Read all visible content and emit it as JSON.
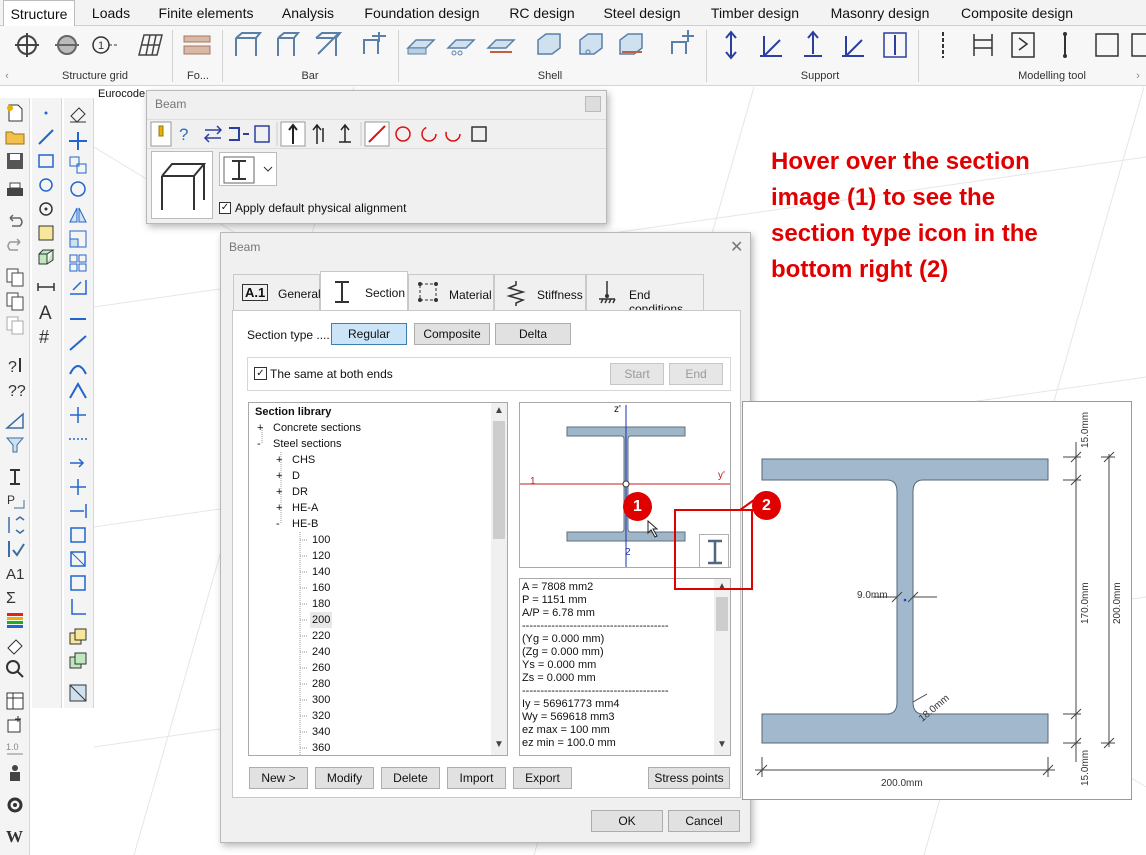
{
  "menu": {
    "tabs": [
      "Structure",
      "Loads",
      "Finite elements",
      "Analysis",
      "Foundation design",
      "RC design",
      "Steel design",
      "Timber design",
      "Masonry design",
      "Composite design"
    ]
  },
  "ribbon": {
    "groups": [
      "Structure grid",
      "Fo...",
      "Bar",
      "Shell",
      "Support",
      "Modelling tool"
    ]
  },
  "viewport": {
    "label": "Eurocode"
  },
  "beam_palette": {
    "title": "Beam",
    "apply_default_label": "Apply default physical alignment",
    "apply_default_checked": true
  },
  "beam_dialog": {
    "title": "Beam",
    "tabs": [
      {
        "label": "General",
        "badge": "A.1"
      },
      {
        "label": "Section"
      },
      {
        "label": "Material"
      },
      {
        "label": "Stiffness"
      },
      {
        "label": "End conditions"
      }
    ],
    "section_type_label": "Section type ....",
    "section_types": [
      "Regular",
      "Composite",
      "Delta"
    ],
    "selected_section_type": "Regular",
    "same_ends_label": "The same at both ends",
    "same_ends_checked": true,
    "start_label": "Start",
    "end_label": "End",
    "library": {
      "heading": "Section library",
      "items": [
        {
          "label": "Concrete sections",
          "toggle": "+"
        },
        {
          "label": "Steel sections",
          "toggle": "-"
        },
        {
          "label": "CHS",
          "toggle": "+"
        },
        {
          "label": "D",
          "toggle": "+"
        },
        {
          "label": "DR",
          "toggle": "+"
        },
        {
          "label": "HE-A",
          "toggle": "+"
        },
        {
          "label": "HE-B",
          "toggle": "-"
        }
      ],
      "sizes": [
        "100",
        "120",
        "140",
        "160",
        "180",
        "200",
        "220",
        "240",
        "260",
        "280",
        "300",
        "320",
        "340",
        "360"
      ],
      "selected_size": "200"
    },
    "preview": {
      "axis_z": "z'",
      "axis_y": "y'",
      "label_1": "1",
      "label_2": "2"
    },
    "properties": [
      "A       =  7808 mm2",
      "P       =  1151 mm",
      "A/P     =  6.78 mm",
      "----------------------------------------",
      "(Yg     =  0.000 mm)",
      "(Zg     =  0.000 mm)",
      "Ys      =  0.000 mm",
      "Zs      =  0.000 mm",
      "----------------------------------------",
      "Iy      =  56961773 mm4",
      "Wy      =  569618 mm3",
      "ez max  =  100 mm",
      "ez min  =  100.0 mm"
    ],
    "buttons": {
      "new": "New >",
      "modify": "Modify",
      "delete": "Delete",
      "import": "Import",
      "export": "Export",
      "stress_points": "Stress points",
      "ok": "OK",
      "cancel": "Cancel"
    }
  },
  "section_detail": {
    "dim_15_top": "15.0mm",
    "dim_170": "170.0mm",
    "dim_200_height": "200.0mm",
    "dim_15_bottom": "15.0mm",
    "dim_web": "9.0mm",
    "dim_radius": "18.0mm",
    "dim_200_width": "200.0mm"
  },
  "annotation": {
    "text": "Hover over the section image (1) to see the section type icon in the bottom right (2)",
    "marker_1": "1",
    "marker_2": "2",
    "color": "#e00000"
  }
}
